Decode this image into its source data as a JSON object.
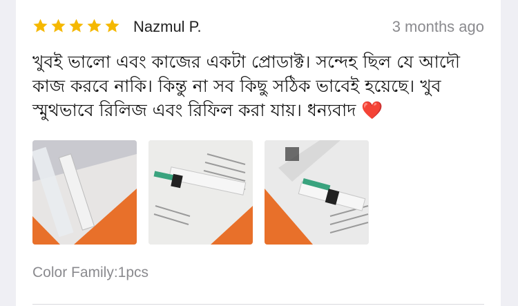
{
  "review": {
    "rating": 5,
    "rating_max": 5,
    "reviewer_name": "Nazmul P.",
    "date": "3 months ago",
    "text": "খুবই ভালো এবং কাজের একটা প্রোডাক্ট। সন্দেহ ছিল যে আদৌ কাজ করবে নাকি। কিন্তু না সব কিছু সঠিক ভাবেই হয়েছে। খুব স্মুথভাবে রিলিজ এবং রিফিল করা যায়।  ধন্যবাদ",
    "text_emoji": "❤️",
    "variant": "Color Family:1pcs"
  },
  "colors": {
    "star": "#f5b800",
    "card": "#ffffff",
    "background": "#efeff4",
    "muted_text": "#8a8a8e"
  },
  "icons": [
    "star-icon"
  ]
}
